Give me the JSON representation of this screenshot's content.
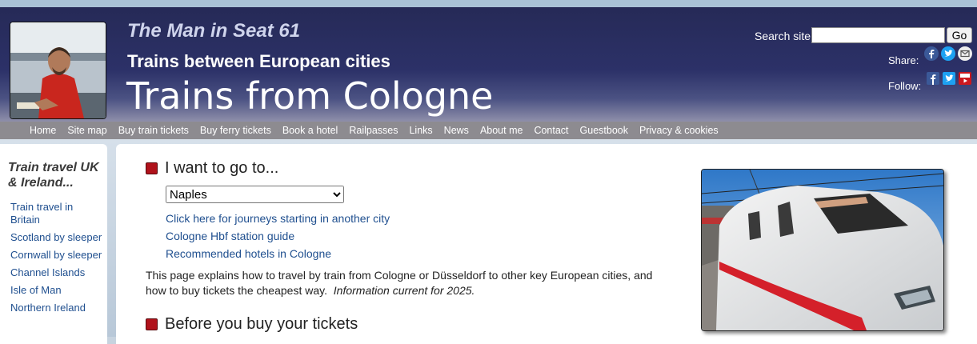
{
  "header": {
    "brand": "The Man in Seat 61",
    "subtitle": "Trains between European cities",
    "title": "Trains from Cologne",
    "search_label": "Search site:",
    "search_value": "",
    "go_label": "Go",
    "share_label": "Share:",
    "follow_label": "Follow:",
    "share_icons": [
      "facebook-icon",
      "twitter-icon",
      "email-icon"
    ],
    "follow_icons": [
      "facebook-icon",
      "twitter-icon",
      "youtube-icon"
    ]
  },
  "nav": {
    "items": [
      "Home",
      "Site map",
      "Buy train tickets",
      "Buy ferry tickets",
      "Book a hotel",
      "Railpasses",
      "Links",
      "News",
      "About me",
      "Contact",
      "Guestbook",
      "Privacy & cookies"
    ]
  },
  "sidebar": {
    "heading": "Train travel UK & Ireland...",
    "links": [
      "Train travel in Britain",
      "Scotland by sleeper",
      "Cornwall by sleeper",
      "Channel Islands",
      "Isle of Man",
      "Northern Ireland"
    ]
  },
  "main": {
    "heading1": "I want to go to...",
    "destination_selected": "Naples",
    "links": [
      "Click here for journeys starting in another city",
      "Cologne Hbf station guide",
      "Recommended hotels in Cologne"
    ],
    "intro_text": "This page explains how to travel by train from Cologne or Düsseldorf to other key European cities, and how to buy tickets the cheapest way.",
    "intro_note": "Information current for 2025.",
    "heading2": "Before you buy your tickets"
  },
  "colors": {
    "header_dark": "#262a57",
    "nav_bg": "#8d8b90",
    "link": "#1f4f8f",
    "bullet": "#b0121b"
  }
}
